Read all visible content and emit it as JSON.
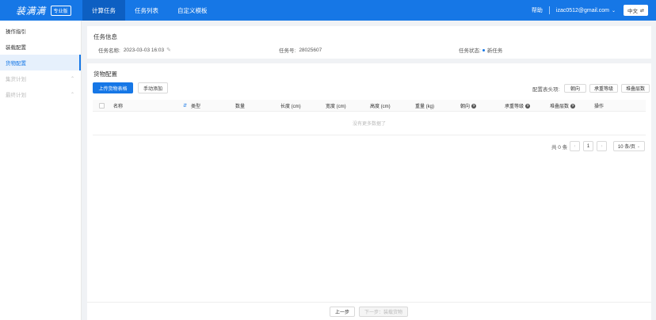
{
  "header": {
    "logo": "装满满",
    "badge": "专业版",
    "nav": [
      "计算任务",
      "任务列表",
      "自定义模板"
    ],
    "help": "帮助",
    "user": "izac0512@gmail.com",
    "lang": "中文"
  },
  "sidebar": {
    "items": [
      {
        "label": "操作指引"
      },
      {
        "label": "装载配置"
      },
      {
        "label": "货物配置"
      },
      {
        "label": "集货计划"
      },
      {
        "label": "最终计划"
      }
    ]
  },
  "task_info": {
    "title": "任务信息",
    "name_label": "任务名称:",
    "name_value": "2023-03-03 16:03",
    "id_label": "任务号:",
    "id_value": "28025607",
    "status_label": "任务状态:",
    "status_value": "新任务"
  },
  "cargo": {
    "title": "货物配置",
    "upload_btn": "上传货物表格",
    "manual_btn": "手动添加",
    "config_label": "配置表头项:",
    "config_options": [
      "朝向",
      "承重等级",
      "堆叠层数"
    ],
    "columns": [
      "名称",
      "类型",
      "数量",
      "长度 (cm)",
      "宽度 (cm)",
      "高度 (cm)",
      "重量 (kg)",
      "朝向",
      "承重等级",
      "堆叠层数",
      "操作"
    ],
    "empty_text": "没有更多数据了",
    "total": "共 0 条",
    "page": "1",
    "page_size": "10 条/页"
  },
  "footer": {
    "prev": "上一步",
    "next": "下一步：装载货物"
  },
  "colors": {
    "primary": "#1677e6"
  }
}
